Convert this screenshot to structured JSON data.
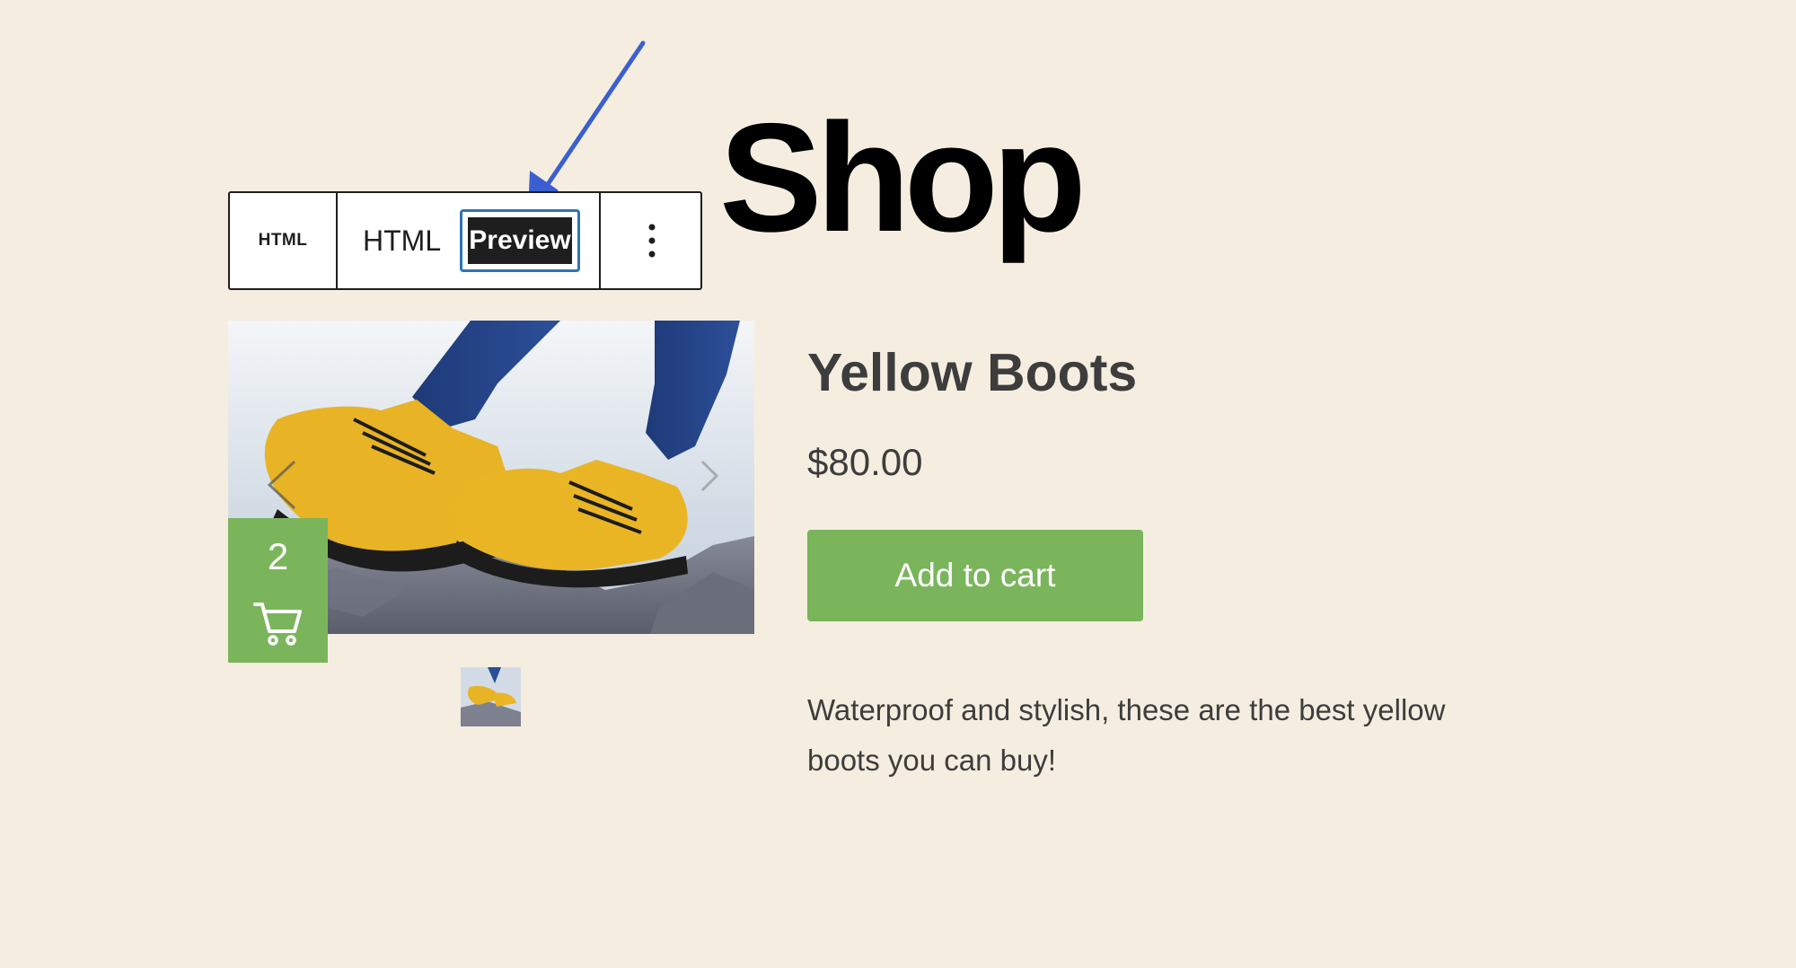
{
  "page": {
    "title": "Shop"
  },
  "block_toolbar": {
    "block_type_label": "HTML",
    "html_tab_label": "HTML",
    "preview_tab_label": "Preview",
    "more_options_icon": "vertical-ellipsis-icon"
  },
  "annotation": {
    "arrow_color": "#3b5fd0"
  },
  "product": {
    "name": "Yellow Boots",
    "price": "$80.00",
    "add_to_cart_label": "Add to cart",
    "description": "Waterproof and stylish, these are the best yellow boots you can buy!",
    "gallery": {
      "prev_icon": "chevron-left-icon",
      "next_icon": "chevron-right-icon"
    }
  },
  "mini_cart": {
    "count": "2",
    "icon": "cart-icon"
  },
  "colors": {
    "accent": "#7ab55c",
    "background": "#f5eee0",
    "text": "#3d3d3d",
    "toolbar_focus": "#2f73b8"
  }
}
